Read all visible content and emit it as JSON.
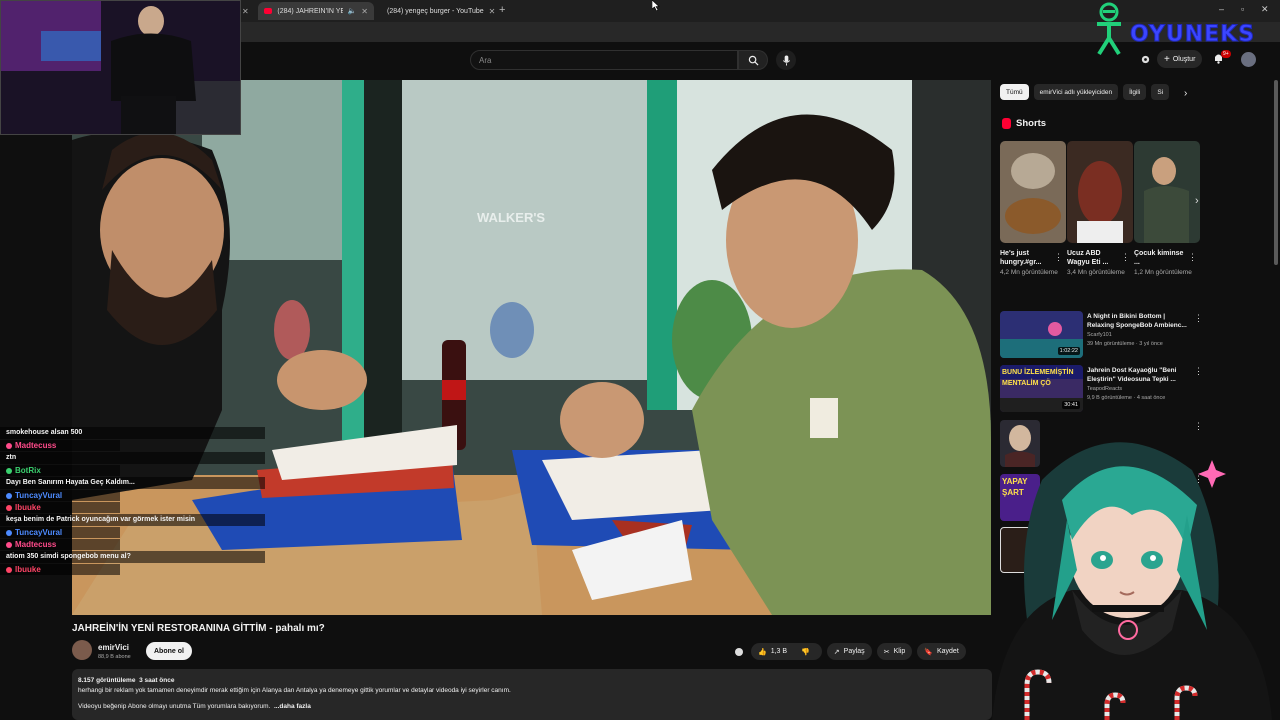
{
  "browser": {
    "tabs": [
      {
        "label": "(284) JAHREIN'İN YENİ RES",
        "active": true
      },
      {
        "label": "(284) yengeç burger - YouTube",
        "active": false
      }
    ],
    "new_tab": "+",
    "window_controls": [
      "–",
      "▫",
      "✕"
    ]
  },
  "overlay_logo": {
    "text": "OYUNEKS"
  },
  "header": {
    "search_placeholder": "Ara",
    "create_label": "Oluştur",
    "notification_badge": "9+"
  },
  "video": {
    "title": "JAHREİN'İN YENİ RESTORANINA GİTTİM - pahalı mı?",
    "channel": "emirVici",
    "subscribers": "88,9 B abone",
    "subscribe_label": "Abone ol",
    "actions": {
      "likes": "1,3 B",
      "share": "Paylaş",
      "clip": "Klip",
      "save": "Kaydet"
    },
    "description": {
      "views": "8.157 görüntüleme",
      "age": "3 saat önce",
      "line1": "herhangi bir reklam yok tamamen deneyimdir merak ettiğim için Alanya dan Antalya ya denemeye gittik yorumlar ve detaylar videoda iyi seyirler canım.",
      "line2": "Videoyu beğenip Abone olmayı unutma Tüm yorumlara bakıyorum.",
      "more": "...daha fazla"
    },
    "sign_text": "WALKER'S"
  },
  "chat": [
    {
      "type": "msg",
      "text": "smokehouse alsan 500"
    },
    {
      "type": "name",
      "name": "Madtecuss",
      "color": "#ff4b8b"
    },
    {
      "type": "msg",
      "text": "ztn"
    },
    {
      "type": "name",
      "name": "BotRix",
      "color": "#3bd16f"
    },
    {
      "type": "msg",
      "text": "Dayı Ben Sanırım Hayata Geç Kaldım..."
    },
    {
      "type": "name",
      "name": "TuncayVural",
      "color": "#4d8bff"
    },
    {
      "type": "name",
      "name": "lbuuke",
      "color": "#ff4466"
    },
    {
      "type": "msg",
      "text": "keşa benim de Patrick oyuncağım var görmek ister misin"
    },
    {
      "type": "name",
      "name": "TuncayVural",
      "color": "#4d8bff"
    },
    {
      "type": "name",
      "name": "Madtecuss",
      "color": "#ff4b8b"
    },
    {
      "type": "msg",
      "text": "atiom 350 simdi spongebob menu al?"
    },
    {
      "type": "name",
      "name": "lbuuke",
      "color": "#ff4466"
    }
  ],
  "sidebar": {
    "chips": [
      "Tümü",
      "emirVici adlı yükleyiciden",
      "İlgili",
      "Si"
    ],
    "shorts_title": "Shorts",
    "shorts": [
      {
        "title": "He's just hungry.#gr...",
        "views": "4,2 Mn görüntüleme"
      },
      {
        "title": "Ucuz ABD Wagyu Eti ...",
        "views": "3,4 Mn görüntüleme"
      },
      {
        "title": "Çocuk kiminse ...",
        "views": "1,2 Mn görüntüleme"
      }
    ],
    "recommendations": [
      {
        "title": "A Night in Bikini Bottom | Relaxing SpongeBob Ambienc...",
        "channel": "Scarfy101",
        "meta": "39 Mn görüntüleme · 3 yıl önce",
        "duration": "1:02:22",
        "thumb_text": ""
      },
      {
        "title": "Jahrein Dost Kayaoğlu \"Beni Eleştirin\" Videosuna Tepki ...",
        "channel": "TeapodReacts",
        "meta": "9,9 B görüntüleme · 4 saat önce",
        "duration": "30:41",
        "thumb_text": "BUNU İZLEMEMİŞTİN MENTALİM ÇÖ"
      },
      {
        "title": "",
        "channel": "",
        "meta": "",
        "duration": "",
        "thumb_text": ""
      },
      {
        "title": "",
        "channel": "",
        "meta": "",
        "duration": "",
        "thumb_text": "YAPAY ŞART"
      }
    ]
  },
  "colors": {
    "accent": "#ff0033",
    "bg": "#0f0f0f",
    "chip": "#272727",
    "logo": "#3b46ff"
  }
}
